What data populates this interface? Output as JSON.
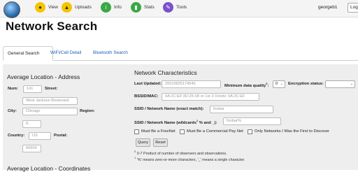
{
  "nav": {
    "items": [
      {
        "label": "View",
        "icon": "eye-icon",
        "color": "#f5c400"
      },
      {
        "label": "Uploads",
        "icon": "upload-icon",
        "color": "#f5c400"
      },
      {
        "label": "Info",
        "icon": "info-icon",
        "color": "#3aa845"
      },
      {
        "label": "Stats",
        "icon": "stats-icon",
        "color": "#3aa845"
      },
      {
        "label": "Tools",
        "icon": "tools-icon",
        "color": "#7b4fc9"
      }
    ],
    "username": "georgeb1",
    "login_label": "Log"
  },
  "page": {
    "title": "Network Search"
  },
  "tabs": [
    {
      "label": "General Search",
      "active": true
    },
    {
      "label": "WiFi/Cell Detail",
      "active": false
    },
    {
      "label": "Bluetooth Search",
      "active": false
    }
  ],
  "address": {
    "heading": "Average Location - Address",
    "num_label": "Num:",
    "num_placeholder": "141",
    "street_label": "Street:",
    "street_placeholder": "West Jackson Boulevard",
    "city_label": "City:",
    "city_placeholder": "Chicago",
    "region_label": "Region:",
    "region_placeholder": "IL",
    "country_label": "Country:",
    "country_placeholder": "US",
    "postal_label": "Postal:",
    "postal_placeholder": "60604"
  },
  "coordinates": {
    "heading": "Average Location - Coordinates"
  },
  "network": {
    "heading": "Network Characteristics",
    "last_updated_label": "Last Updated:",
    "last_updated_placeholder": "20010925174546",
    "min_quality_label": "Minimum data quality",
    "min_quality_sup": "0",
    "min_quality_value": "0",
    "encryption_label": "Encryption status:",
    "encryption_value": "",
    "bssid_label": "BSSID/MAC:",
    "bssid_placeholder": "0A:2C:EF:3D:25:1B or 1st 3 Octets: 0A:2C:EF",
    "ssid_exact_label": "SSID / Network Name (exact match):",
    "ssid_exact_placeholder": "foobar",
    "ssid_wild_label": "SSID / Network Name (wildcards",
    "ssid_wild_sup": "1",
    "ssid_wild_suffix": " % and _):",
    "ssid_wild_placeholder": "foobar%",
    "check_freenet": "Must Be a FreeNet",
    "check_paynet": "Must Be a Commercial Pay Net",
    "check_first": "Only Networks I Was the First to Discover",
    "query_label": "Query",
    "reset_label": "Reset",
    "note0": "0-7 Product of number of observers and observations.",
    "note0_sup": "0",
    "note1": "'%' means zero-or-more characters, '_' means a single character.",
    "note1_sup": "1"
  }
}
